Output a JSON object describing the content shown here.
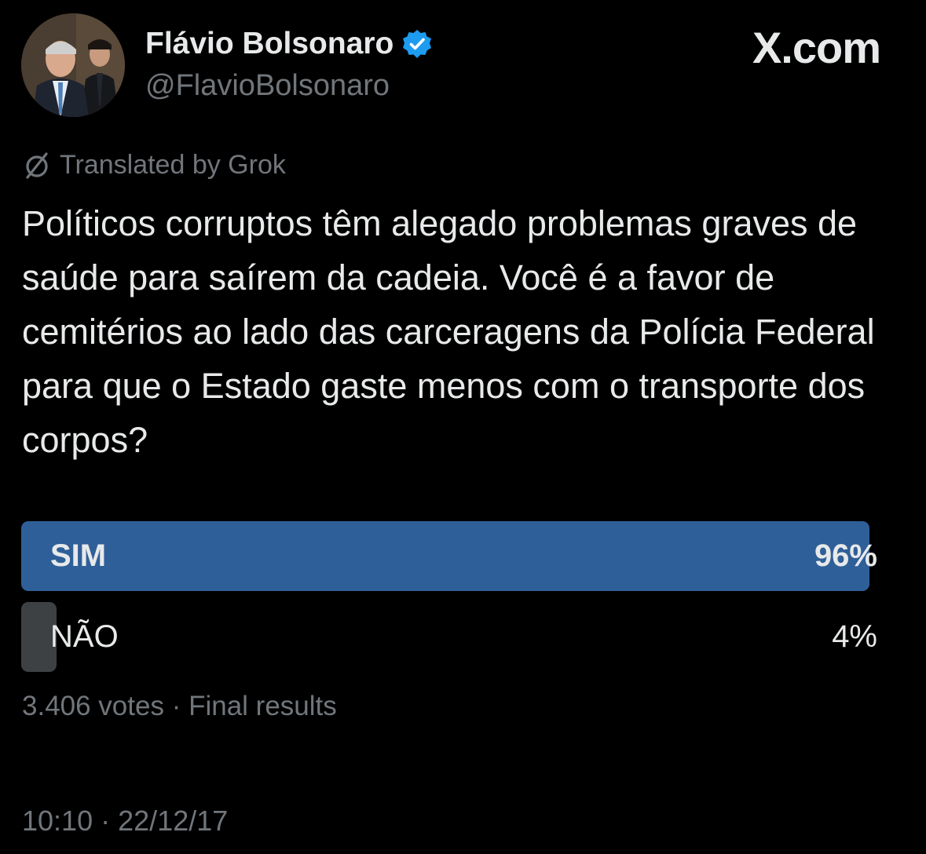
{
  "author": {
    "name": "Flávio Bolsonaro",
    "handle": "@FlavioBolsonaro",
    "verified": true
  },
  "brand": "X.com",
  "translation": {
    "label": "Translated by Grok"
  },
  "tweet": {
    "text": "Políticos corruptos têm alegado problemas graves de saúde para saírem da cadeia. Você é a favor de cemitérios ao lado das carceragens da Polícia Federal para que o Estado gaste menos com o transporte dos corpos?"
  },
  "poll": {
    "options": [
      {
        "label": "SIM",
        "percent_label": "96%",
        "percent": 96,
        "winner": true
      },
      {
        "label": "NÃO",
        "percent_label": "4%",
        "percent": 4,
        "winner": false
      }
    ],
    "votes_label": "3.406 votes",
    "separator": "·",
    "status": "Final results"
  },
  "timestamp": {
    "time": "10:10",
    "separator": "·",
    "date": "22/12/17"
  },
  "colors": {
    "background": "#000000",
    "text_primary": "#e7e9ea",
    "text_secondary": "#71767b",
    "verified_badge": "#1d9bf0",
    "poll_winner": "#2f5f98",
    "poll_other": "#3e4144"
  },
  "icons": {
    "verified": "verified-badge-icon",
    "translate": "grok-translate-icon"
  }
}
